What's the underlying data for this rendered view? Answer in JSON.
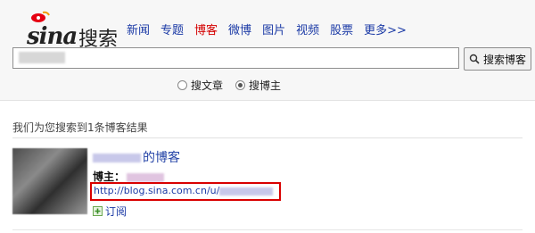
{
  "logo": {
    "text": "sina",
    "sub": "搜索"
  },
  "nav": [
    {
      "label": "新闻",
      "active": false
    },
    {
      "label": "专题",
      "active": false
    },
    {
      "label": "博客",
      "active": true
    },
    {
      "label": "微博",
      "active": false
    },
    {
      "label": "图片",
      "active": false
    },
    {
      "label": "视频",
      "active": false
    },
    {
      "label": "股票",
      "active": false
    },
    {
      "label": "更多>>",
      "active": false
    }
  ],
  "search": {
    "button_label": "搜索博客"
  },
  "radios": [
    {
      "label": "搜文章",
      "checked": false
    },
    {
      "label": "搜博主",
      "checked": true
    }
  ],
  "results": {
    "count_text": "我们为您搜索到1条博客结果",
    "items": [
      {
        "title_suffix": "的博客",
        "blogger_label": "博主：",
        "url_prefix": "http://blog.sina.com.cn/u/",
        "subscribe_label": "订阅"
      }
    ]
  },
  "colors": {
    "link": "#1b3aa6",
    "active_nav": "#d40000",
    "highlight_box": "#d90000"
  }
}
